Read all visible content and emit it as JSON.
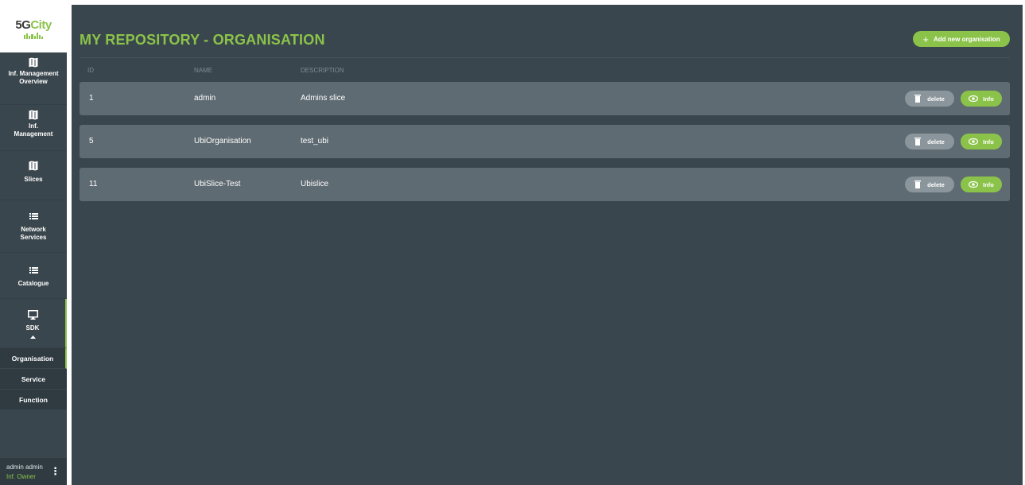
{
  "brand": {
    "logo_text_1": "5G",
    "logo_text_2": "City",
    "accent_color": "#8bc34a"
  },
  "sidebar": {
    "items": [
      {
        "label": "Inf. Management Overview",
        "icon": "map-icon"
      },
      {
        "label": "Inf. Management",
        "icon": "map-icon"
      },
      {
        "label": "Slices",
        "icon": "map-icon"
      },
      {
        "label": "Network Services",
        "icon": "list-icon"
      },
      {
        "label": "Catalogue",
        "icon": "list-icon"
      },
      {
        "label": "SDK",
        "icon": "monitor-icon"
      }
    ],
    "sdk_sub": [
      "Organisation",
      "Service",
      "Function"
    ],
    "active_sub": "Organisation"
  },
  "user": {
    "name": "admin admin",
    "role": "Inf. Owner"
  },
  "main": {
    "title": "MY REPOSITORY - ORGANISATION",
    "add_button": "Add new organisation",
    "columns": [
      "ID",
      "NAME",
      "DESCRIPTION"
    ],
    "rows": [
      {
        "id": "1",
        "name": "admin",
        "description": "Admins slice"
      },
      {
        "id": "5",
        "name": "UbiOrganisation",
        "description": "test_ubi"
      },
      {
        "id": "11",
        "name": "UbiSlice-Test",
        "description": "Ubislice"
      }
    ],
    "delete_label": "delete",
    "info_label": "Info"
  }
}
